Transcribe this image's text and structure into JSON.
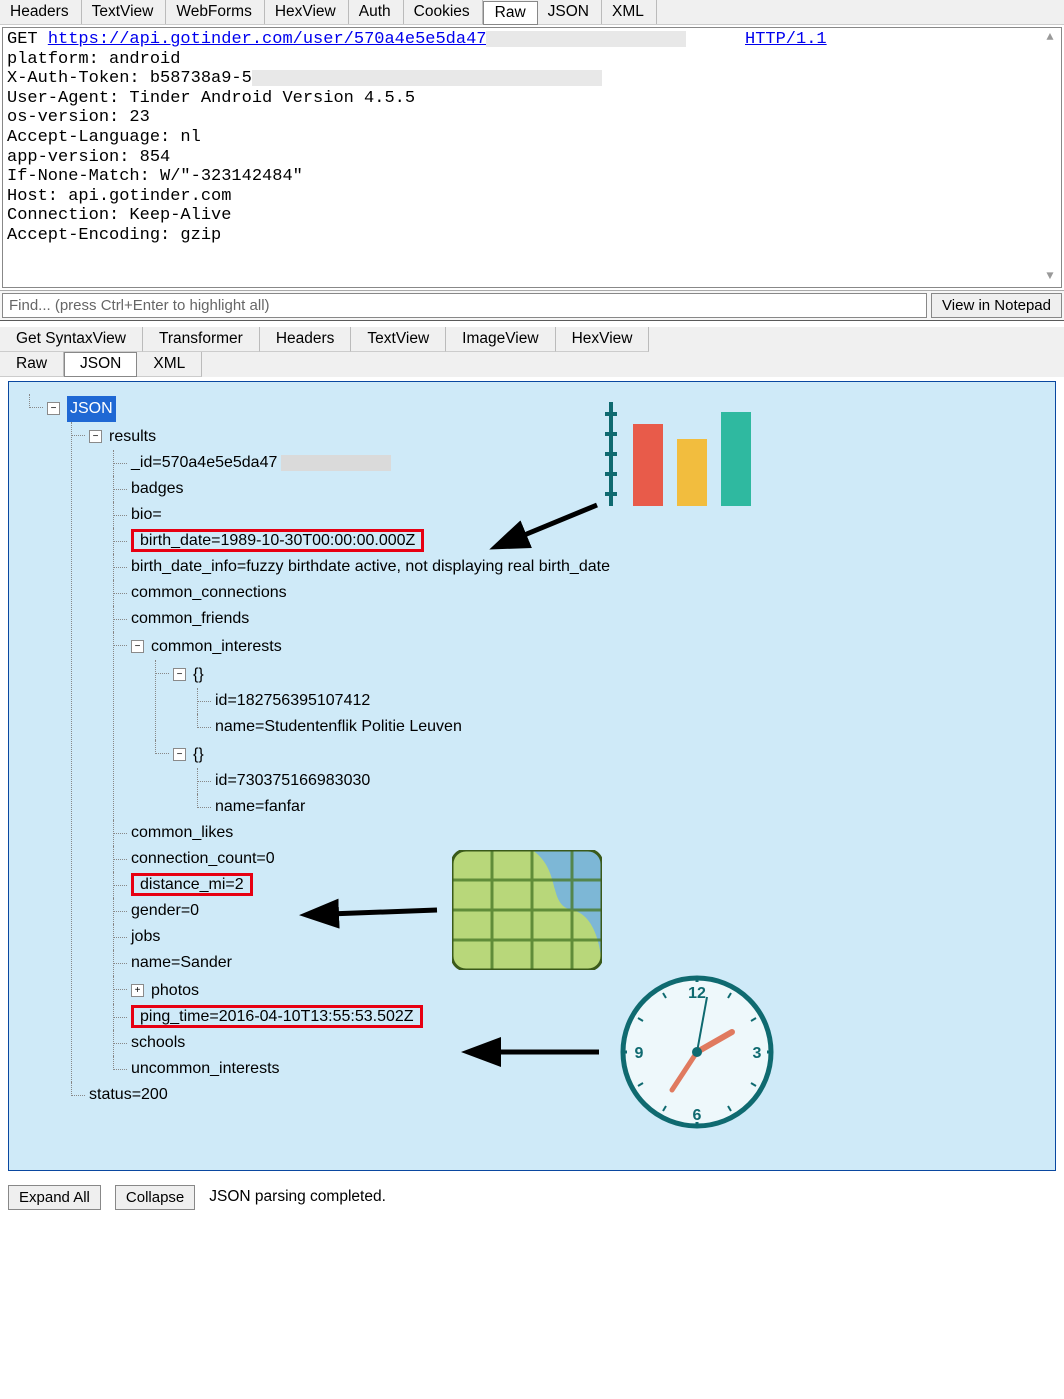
{
  "request_tabs": [
    "Headers",
    "TextView",
    "WebForms",
    "HexView",
    "Auth",
    "Cookies",
    "Raw",
    "JSON",
    "XML"
  ],
  "request_tabs_selected": "Raw",
  "raw_request": {
    "method_url_prefix": "GET ",
    "url": "https://api.gotinder.com/user/570a4e5e5da47",
    "http_suffix": "HTTP/1.1",
    "lines": [
      "platform: android",
      "X-Auth-Token: b58738a9-5",
      "User-Agent: Tinder Android Version 4.5.5",
      "os-version: 23",
      "Accept-Language: nl",
      "app-version: 854",
      "If-None-Match: W/\"-323142484\"",
      "Host: api.gotinder.com",
      "Connection: Keep-Alive",
      "Accept-Encoding: gzip"
    ]
  },
  "find": {
    "placeholder": "Find... (press Ctrl+Enter to highlight all)"
  },
  "view_in_notepad_label": "View in Notepad",
  "response_tabs_row1": [
    "Get SyntaxView",
    "Transformer",
    "Headers",
    "TextView",
    "ImageView",
    "HexView"
  ],
  "response_tabs_row2": [
    "Raw",
    "JSON",
    "XML"
  ],
  "response_tabs_selected": "JSON",
  "tree": {
    "root": "JSON",
    "results_label": "results",
    "id": "_id=570a4e5e5da47",
    "badges": "badges",
    "bio": "bio=",
    "birth_date": "birth_date=1989-10-30T00:00:00.000Z",
    "birth_date_info": "birth_date_info=fuzzy birthdate active, not displaying real birth_date",
    "common_connections": "common_connections",
    "common_friends": "common_friends",
    "common_interests_label": "common_interests",
    "ci0_brace": "{}",
    "ci0_id": "id=182756395107412",
    "ci0_name": "name=Studentenflik Politie Leuven",
    "ci1_brace": "{}",
    "ci1_id": "id=730375166983030",
    "ci1_name": "name=fanfar",
    "common_likes": "common_likes",
    "connection_count": "connection_count=0",
    "distance_mi": "distance_mi=2",
    "gender": "gender=0",
    "jobs": "jobs",
    "name": "name=Sander",
    "photos": "photos",
    "ping_time": "ping_time=2016-04-10T13:55:53.502Z",
    "schools": "schools",
    "uncommon_interests": "uncommon_interests",
    "status": "status=200"
  },
  "buttons": {
    "expand": "Expand All",
    "collapse": "Collapse"
  },
  "status_msg": "JSON parsing completed."
}
